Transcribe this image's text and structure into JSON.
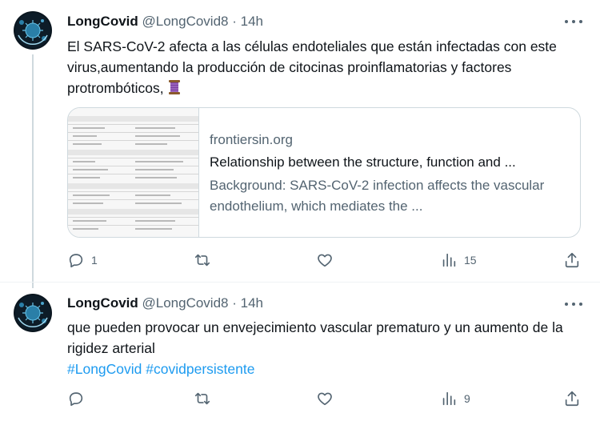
{
  "tweets": [
    {
      "author": {
        "name": "LongCovid",
        "handle": "@LongCovid8",
        "avatar_icon": "virus-avatar-icon"
      },
      "separator": "·",
      "time": "14h",
      "text": "El SARS-CoV-2 afecta a las células endoteliales que están infectadas con este virus,aumentando la producción de citocinas proinflamatorias y factores protrombóticos,",
      "emoji": "thread-spool-emoji",
      "card": {
        "domain": "frontiersin.org",
        "title": "Relationship between the structure, function and ...",
        "description": "Background: SARS-CoV-2 infection affects the vascular endothelium, which mediates the ..."
      },
      "actions": {
        "replies": "1",
        "retweets": "",
        "likes": "",
        "views": "15"
      }
    },
    {
      "author": {
        "name": "LongCovid",
        "handle": "@LongCovid8",
        "avatar_icon": "virus-avatar-icon"
      },
      "separator": "·",
      "time": "14h",
      "text": "que pueden provocar un envejecimiento vascular prematuro y un aumento de la rigidez arterial",
      "hashtags": "#LongCovid #covidpersistente",
      "actions": {
        "replies": "",
        "retweets": "",
        "likes": "",
        "views": "9"
      }
    }
  ],
  "colors": {
    "text": "#0f1419",
    "muted": "#536471",
    "link": "#1d9bf0",
    "border": "#cfd9de"
  }
}
